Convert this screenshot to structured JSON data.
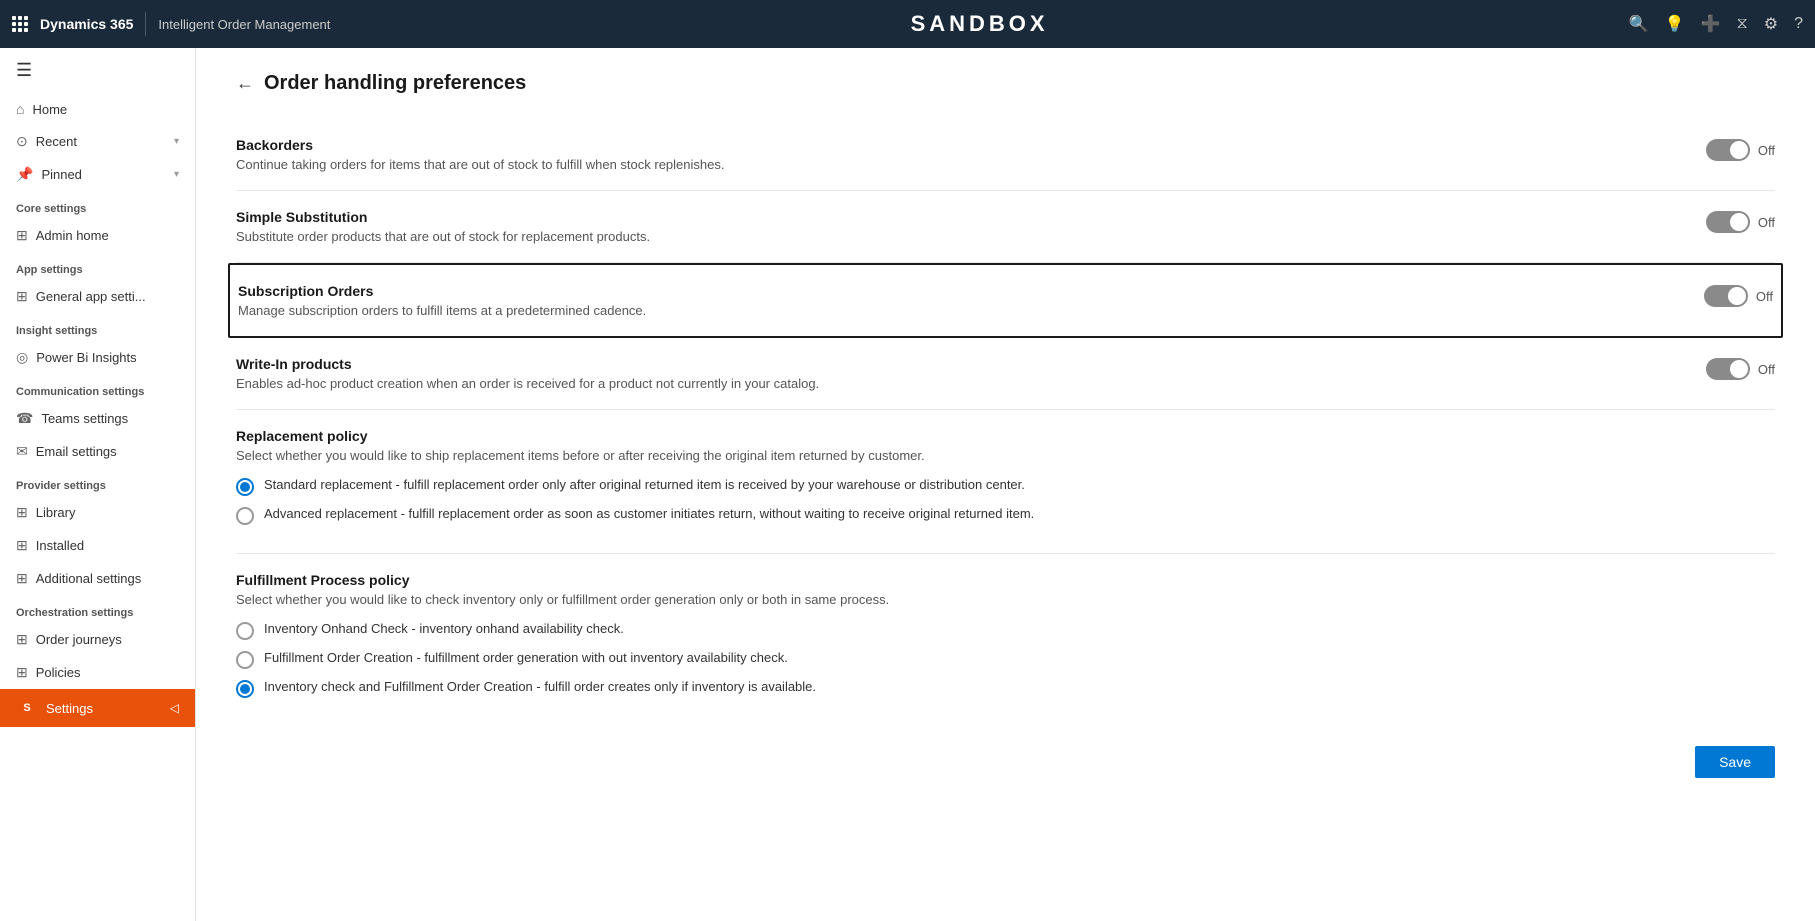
{
  "topnav": {
    "brand": "Dynamics 365",
    "app": "Intelligent Order Management",
    "sandbox": "SANDBOX"
  },
  "sidebar": {
    "hamburger": "☰",
    "nav": [
      {
        "id": "home",
        "icon": "⌂",
        "label": "Home"
      },
      {
        "id": "recent",
        "icon": "⊙",
        "label": "Recent",
        "chevron": "▾"
      },
      {
        "id": "pinned",
        "icon": "📌",
        "label": "Pinned",
        "chevron": "▾"
      }
    ],
    "sections": [
      {
        "title": "Core settings",
        "items": [
          {
            "id": "admin-home",
            "icon": "⊞",
            "label": "Admin home"
          }
        ]
      },
      {
        "title": "App settings",
        "items": [
          {
            "id": "general-app",
            "icon": "⊞",
            "label": "General app setti..."
          }
        ]
      },
      {
        "title": "Insight settings",
        "items": [
          {
            "id": "power-bi",
            "icon": "◎",
            "label": "Power Bi Insights"
          }
        ]
      },
      {
        "title": "Communication settings",
        "items": [
          {
            "id": "teams",
            "icon": "☎",
            "label": "Teams settings"
          },
          {
            "id": "email",
            "icon": "✉",
            "label": "Email settings"
          }
        ]
      },
      {
        "title": "Provider settings",
        "items": [
          {
            "id": "library",
            "icon": "⊞",
            "label": "Library"
          },
          {
            "id": "installed",
            "icon": "⊞",
            "label": "Installed"
          },
          {
            "id": "additional",
            "icon": "⊞",
            "label": "Additional settings"
          }
        ]
      },
      {
        "title": "Orchestration settings",
        "items": [
          {
            "id": "order-journeys",
            "icon": "⊞",
            "label": "Order journeys"
          },
          {
            "id": "policies",
            "icon": "⊞",
            "label": "Policies"
          }
        ]
      }
    ],
    "bottom": {
      "avatar": "S",
      "label": "Settings",
      "chevron": "◁"
    }
  },
  "page": {
    "back_label": "←",
    "title": "Order handling preferences",
    "settings": [
      {
        "id": "backorders",
        "name": "Backorders",
        "description": "Continue taking orders for items that are out of stock to fulfill when stock replenishes.",
        "toggle": "Off",
        "enabled": false,
        "highlighted": false
      },
      {
        "id": "simple-substitution",
        "name": "Simple Substitution",
        "description": "Substitute order products that are out of stock for replacement products.",
        "toggle": "Off",
        "enabled": false,
        "highlighted": false
      },
      {
        "id": "subscription-orders",
        "name": "Subscription Orders",
        "description": "Manage subscription orders to fulfill items at a predetermined cadence.",
        "toggle": "Off",
        "enabled": false,
        "highlighted": true
      },
      {
        "id": "write-in-products",
        "name": "Write-In products",
        "description": "Enables ad-hoc product creation when an order is received for a product not currently in your catalog.",
        "toggle": "Off",
        "enabled": false,
        "highlighted": false
      }
    ],
    "replacement_policy": {
      "title": "Replacement policy",
      "description": "Select whether you would like to ship replacement items before or after receiving the original item returned by customer.",
      "options": [
        {
          "id": "standard-replacement",
          "label": "Standard replacement - fulfill replacement order only after original returned item is received by your warehouse or distribution center.",
          "selected": true
        },
        {
          "id": "advanced-replacement",
          "label": "Advanced replacement - fulfill replacement order as soon as customer initiates return, without waiting to receive original returned item.",
          "selected": false
        }
      ]
    },
    "fulfillment_policy": {
      "title": "Fulfillment Process policy",
      "description": "Select whether you would like to check inventory only or fulfillment order generation only or both in same process.",
      "options": [
        {
          "id": "inventory-onhand",
          "label": "Inventory Onhand Check - inventory onhand availability check.",
          "selected": false
        },
        {
          "id": "fulfillment-order-creation",
          "label": "Fulfillment Order Creation - fulfillment order generation with out inventory availability check.",
          "selected": false
        },
        {
          "id": "inventory-check-fulfillment",
          "label": "Inventory check and Fulfillment Order Creation - fulfill order creates only if inventory is available.",
          "selected": true
        }
      ]
    },
    "save_label": "Save"
  }
}
